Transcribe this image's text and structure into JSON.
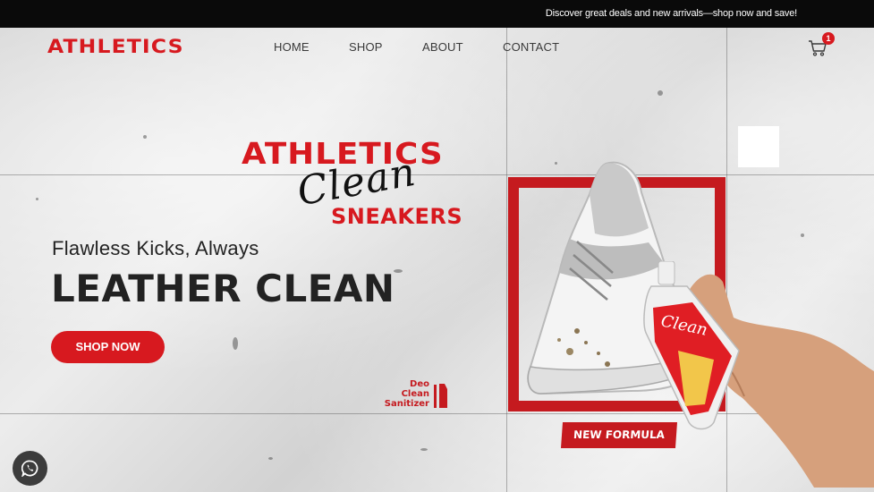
{
  "announcement": {
    "text": "Discover great deals and new arrivals—shop now and save!"
  },
  "header": {
    "logo_text": "ATHLETICS",
    "nav": [
      {
        "label": "HOME"
      },
      {
        "label": "SHOP"
      },
      {
        "label": "ABOUT"
      },
      {
        "label": "CONTACT"
      }
    ],
    "cart_count": "1",
    "cart_icon": "shopping-cart-icon"
  },
  "hero": {
    "brand_top": "ATHLETICS",
    "brand_script": "Clean",
    "brand_bottom": "SNEAKERS",
    "tagline": "Flawless Kicks, Always",
    "headline": "LEATHER CLEAN",
    "cta_label": "SHOP NOW",
    "badge_lines": [
      "Deo",
      "Clean",
      "Sanitizer"
    ],
    "new_formula_label": "NEW FORMULA"
  },
  "widgets": {
    "chat_icon": "whatsapp-icon"
  },
  "colors": {
    "brand_red": "#d7191f",
    "dark_red": "#c51a1f",
    "topbar": "#0a0a0a",
    "text_dark": "#222222"
  }
}
